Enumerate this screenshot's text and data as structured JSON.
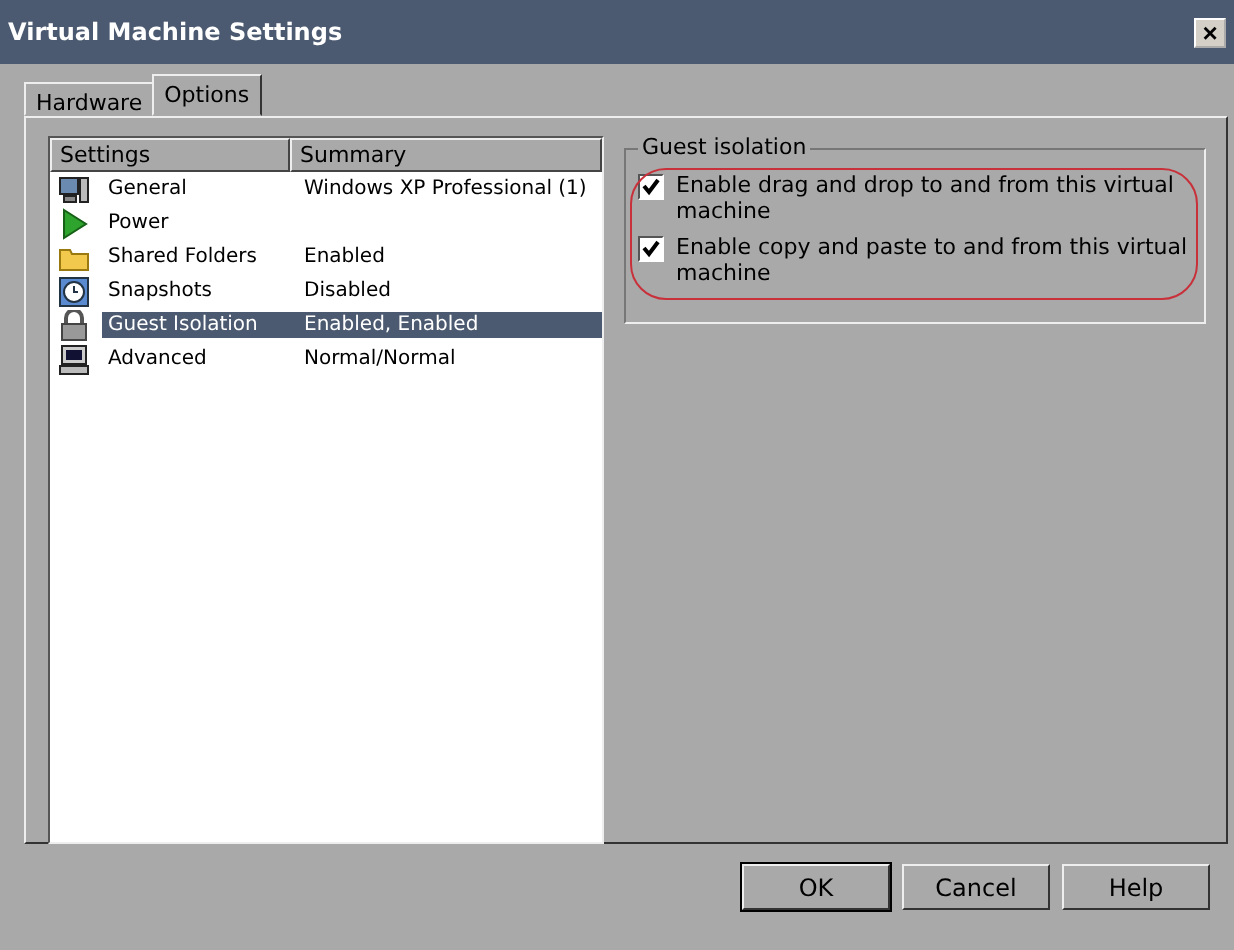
{
  "window": {
    "title": "Virtual Machine Settings",
    "close": "×"
  },
  "tabs": [
    {
      "label": "Hardware",
      "selected": false
    },
    {
      "label": "Options",
      "selected": true
    }
  ],
  "settings_list": {
    "columns": [
      "Settings",
      "Summary"
    ],
    "rows": [
      {
        "kind": "general",
        "name": "General",
        "summary": "Windows XP Professional (1)",
        "selected": false
      },
      {
        "kind": "power",
        "name": "Power",
        "summary": "",
        "selected": false
      },
      {
        "kind": "folder",
        "name": "Shared Folders",
        "summary": "Enabled",
        "selected": false
      },
      {
        "kind": "snapshot",
        "name": "Snapshots",
        "summary": "Disabled",
        "selected": false
      },
      {
        "kind": "lock",
        "name": "Guest Isolation",
        "summary": "Enabled, Enabled",
        "selected": true
      },
      {
        "kind": "computer",
        "name": "Advanced",
        "summary": "Normal/Normal",
        "selected": false
      }
    ]
  },
  "group": {
    "title": "Guest isolation",
    "options": [
      {
        "label": "Enable drag and drop to and from this virtual machine",
        "checked": true
      },
      {
        "label": "Enable copy and paste to and from this virtual machine",
        "checked": true
      }
    ]
  },
  "buttons": [
    "OK",
    "Cancel",
    "Help"
  ]
}
